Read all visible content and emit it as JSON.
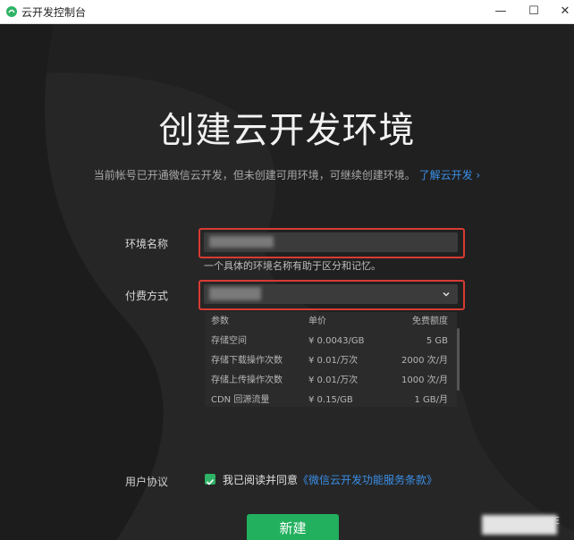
{
  "window": {
    "title": "云开发控制台",
    "minimize_glyph": "—",
    "maximize_glyph": "☐",
    "close_glyph": "✕"
  },
  "page": {
    "heading": "创建云开发环境",
    "subtitle": "当前帐号已开通微信云开发，但未创建可用环境，可继续创建环境。",
    "learn_more": "了解云开发 ›"
  },
  "form": {
    "env_name_label": "环境名称",
    "env_name_hint": "一个具体的环境名称有助于区分和记忆。",
    "payment_label": "付费方式"
  },
  "pricing": {
    "headers": [
      "参数",
      "单价",
      "免费额度"
    ],
    "rows": [
      [
        "存储空间",
        "¥ 0.0043/GB",
        "5 GB"
      ],
      [
        "存储下载操作次数",
        "¥ 0.01/万次",
        "2000 次/月"
      ],
      [
        "存储上传操作次数",
        "¥ 0.01/万次",
        "1000 次/月"
      ],
      [
        "CDN 回源流量",
        "¥ 0.15/GB",
        "1 GB/月"
      ]
    ]
  },
  "agreement": {
    "label": "用户协议",
    "text": "我已阅读并同意",
    "link": "《微信云开发功能服务条款》",
    "checked": true
  },
  "create_button": "新建",
  "corner_text": "E",
  "colors": {
    "accent": "#22b05e",
    "link": "#3a8fe8",
    "highlight": "#d83b33"
  },
  "icons": [
    "app-icon",
    "chevron-down-icon",
    "checkmark-icon"
  ]
}
